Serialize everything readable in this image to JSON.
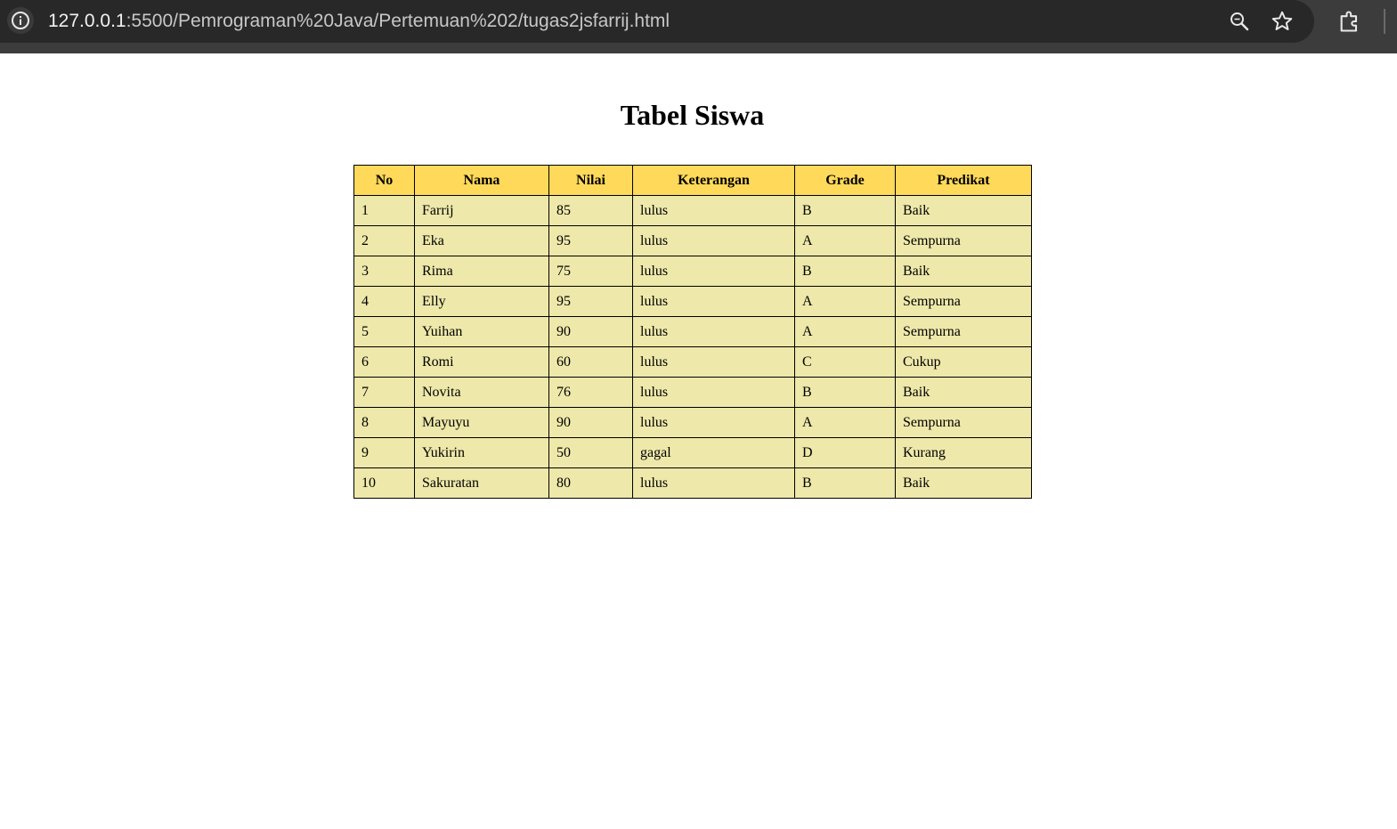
{
  "browser": {
    "url_host": "127.0.0.1",
    "url_rest": ":5500/Pemrograman%20Java/Pertemuan%202/tugas2jsfarrij.html",
    "icons": [
      "info-icon",
      "zoom-icon",
      "star-icon",
      "extensions-icon"
    ]
  },
  "page": {
    "title": "Tabel Siswa"
  },
  "table": {
    "headers": [
      "No",
      "Nama",
      "Nilai",
      "Keterangan",
      "Grade",
      "Predikat"
    ],
    "rows": [
      [
        "1",
        "Farrij",
        "85",
        "lulus",
        "B",
        "Baik"
      ],
      [
        "2",
        "Eka",
        "95",
        "lulus",
        "A",
        "Sempurna"
      ],
      [
        "3",
        "Rima",
        "75",
        "lulus",
        "B",
        "Baik"
      ],
      [
        "4",
        "Elly",
        "95",
        "lulus",
        "A",
        "Sempurna"
      ],
      [
        "5",
        "Yuihan",
        "90",
        "lulus",
        "A",
        "Sempurna"
      ],
      [
        "6",
        "Romi",
        "60",
        "lulus",
        "C",
        "Cukup"
      ],
      [
        "7",
        "Novita",
        "76",
        "lulus",
        "B",
        "Baik"
      ],
      [
        "8",
        "Mayuyu",
        "90",
        "lulus",
        "A",
        "Sempurna"
      ],
      [
        "9",
        "Yukirin",
        "50",
        "gagal",
        "D",
        "Kurang"
      ],
      [
        "10",
        "Sakuratan",
        "80",
        "lulus",
        "B",
        "Baik"
      ]
    ]
  },
  "colors": {
    "header_bg": "#ffd95a",
    "cell_bg": "#eee8aa",
    "toolbar_bg": "#282828"
  }
}
